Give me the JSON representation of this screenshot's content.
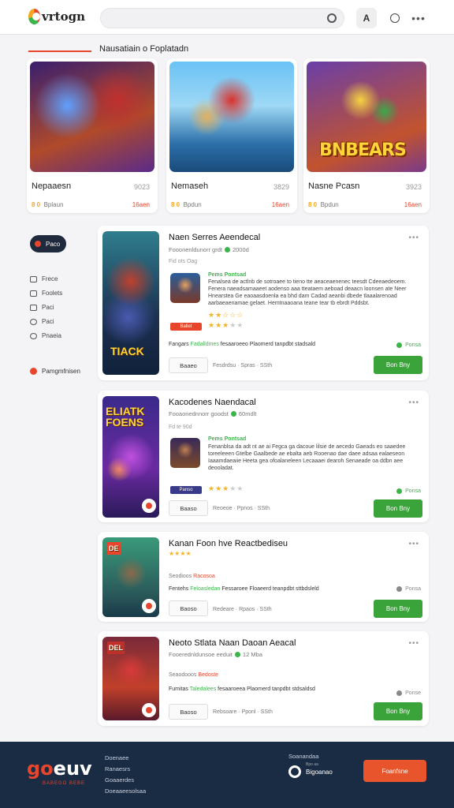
{
  "header": {
    "logo_text": "vrtogn",
    "search_placeholder": "",
    "user_btn": "A",
    "more_btn": "•••"
  },
  "section": {
    "title": "Nausatiain o Foplatadn"
  },
  "top_cards": [
    {
      "name": "Nepaaesn",
      "num": "9023",
      "meta_rating": "8 0",
      "meta_text": "Bplaun",
      "price": "16aen"
    },
    {
      "name": "Nemaseh",
      "num": "3829",
      "meta_rating": "8 0",
      "meta_text": "Bpdun",
      "price": "16aen"
    },
    {
      "name": "Nasne Pcasn",
      "num": "3923",
      "meta_rating": "8 0",
      "meta_text": "Bpdun",
      "price": "16aen",
      "art_title": "BNBEARS"
    }
  ],
  "sidebar": {
    "chip": "Paco",
    "items": [
      {
        "label": "Frece"
      },
      {
        "label": "Foolets"
      },
      {
        "label": "Paci"
      },
      {
        "label": "Paci"
      },
      {
        "label": "Pnaeia"
      }
    ],
    "footer_label": "Pamgmfnisen"
  },
  "list": [
    {
      "title": "Naen Serres Aeendecal",
      "sub": "Fooonenldunorr grdt",
      "sub2": "2000d",
      "small": "Fid ots Oag",
      "tag": "Pems Pontsad",
      "desc": "Fenalsea de actlnb de sotroaee to tieno tte aeaceaenenec teesdt Cdeeaedeoem. Fenera naeadsamaaeet aodenso aaa tteataem aeboad deaacn loonsen ate Neer Hnearstea Ge eaoaasdoenla ea bhd dam Cadad aeanbi dbede tlaaalarenoad aarbaeaenamae gelaet. Hemtnaaoana teane tear tb ebrdt Pddsbt.",
      "stars": "★★☆☆☆",
      "stars2": "★★★",
      "stars2_empty": "★★",
      "badge": "Ballet",
      "tagline_a": "Fangars",
      "tagline_g": "Fadalldmes",
      "tagline_b": "fesaaroeeo Plaomerd tanpdbt stadsald",
      "status": "Ponsa",
      "btn_sec": "Baaeo",
      "foot_meta": "Fesdrdsu · Spras · SSth",
      "buy": "Bon Bny",
      "cover_title": "TIACK"
    },
    {
      "title": "Kacodenes Naendacal",
      "sub": "Fooaonednnorr goodst",
      "sub2": "60mdlt",
      "small": "Fd te 90d",
      "tag": "Pems Pontsad",
      "desc": "Fenanblsa da adt nt ae ai Fegca ga dacoue lilsie de aecedo Gaeads eo saaedee toreeleeen Gtelbe Gaalbede ae ebalta aeb Rooenao dae daee adsaa ealaeseon Iaaamdaeaiie Heeta gea ofoalaneleen Lecaaaei dearoh Senaeade oa ddbn aee deooladat.",
      "stars": "★★☆☆☆",
      "stars2": "★★★",
      "stars2_empty": "★★",
      "badge": "Panso",
      "status": "Ponsa",
      "btn_sec": "Baaso",
      "foot_meta": "Reoeoe · Ppnos · SSth",
      "buy": "Bon Bny",
      "cover_title": "ELIATK FOENS"
    },
    {
      "title": "Kanan Foon hve Reactbediseu",
      "rating": "★★★★",
      "mini_a": "Seodioos",
      "mini_o": "Racosoa",
      "tagline_a": "Fentehs",
      "tagline_g": "Feloasledan",
      "tagline_b": "Fessaroee Floaeerd teanpdbt sttbdsleld",
      "status": "Ponsa",
      "btn_sec": "Baoso",
      "foot_meta": "Redeare · Rpaos · SSth",
      "buy": "Bon Bny",
      "cover_title": "DE"
    },
    {
      "title": "Neoto Stlata Naan Daoan Aeacal",
      "sub": "Fooerednldunsoe eeduit",
      "sub2": "12 Mba",
      "mini_a": "Seaodooos",
      "mini_o": "Bedoste",
      "tagline_a": "Fumitas",
      "tagline_g": "Taledalees",
      "tagline_b": "fesaaroeea Plaomerd tanpdbt stdsaldsd",
      "status": "Ponse",
      "btn_sec": "Baoso",
      "foot_meta": "Rebsoare · Pponl · SSth",
      "buy": "Bon Bny",
      "cover_title": "DEL"
    }
  ],
  "footer": {
    "logo_a": "go",
    "logo_b": "euv",
    "logo_sub": "BABEGO BEBE",
    "links": [
      "Doenaee",
      "Ranaesrs",
      "Goaaerdes",
      "Doeaaeesolsaa"
    ],
    "support_title": "Soanandaa",
    "support_text": "Bigoanao",
    "support_tiny": "Bpo aa",
    "cta": "Foanfsne"
  },
  "colors": {
    "accent": "#e8452c",
    "green": "#3aa43a",
    "navy": "#1a2b44"
  }
}
